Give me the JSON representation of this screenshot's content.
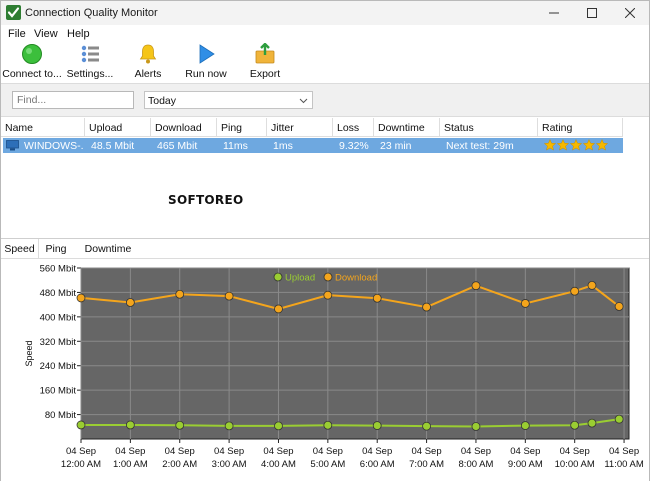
{
  "window": {
    "title": "Connection Quality Monitor"
  },
  "menu": [
    "File",
    "View",
    "Help"
  ],
  "toolbar": [
    {
      "label": "Connect to...",
      "icon": "green-circle-icon"
    },
    {
      "label": "Settings...",
      "icon": "settings-list-icon"
    },
    {
      "label": "Alerts",
      "icon": "bell-icon"
    },
    {
      "label": "Run now",
      "icon": "play-icon"
    },
    {
      "label": "Export",
      "icon": "export-icon"
    }
  ],
  "filter": {
    "find_placeholder": "Find...",
    "period_value": "Today"
  },
  "grid": {
    "columns": [
      "Name",
      "Upload",
      "Download",
      "Ping",
      "Jitter",
      "Loss",
      "Downtime",
      "Status",
      "Rating"
    ],
    "row": {
      "name": "WINDOWS-...",
      "upload": "48.5 Mbit",
      "download": "465 Mbit",
      "ping": "11ms",
      "jitter": "1ms",
      "loss": "9.32%",
      "downtime": "23 min",
      "status": "Next test: 29m",
      "rating": 5,
      "rating_max": 5
    }
  },
  "watermark": "SOFTOREO",
  "tabs": [
    "Speed",
    "Ping",
    "Downtime"
  ],
  "colors": {
    "selection": "#6ea8e0",
    "upload": "#9acd32",
    "download": "#f4a51c",
    "plot_bg": "#666666",
    "star": "#f5b800"
  },
  "chart_data": {
    "type": "line",
    "ylabel": "Speed",
    "ylim": [
      0,
      560
    ],
    "yticks": [
      80,
      160,
      240,
      320,
      400,
      480,
      560
    ],
    "ytick_labels": [
      "80 Mbit",
      "160 Mbit",
      "240 Mbit",
      "320 Mbit",
      "400 Mbit",
      "480 Mbit",
      "560 Mbit"
    ],
    "xlim": [
      0,
      11.1
    ],
    "x": [
      0,
      1,
      2,
      3,
      4,
      5,
      6,
      7,
      8,
      9,
      10,
      10.35,
      10.9
    ],
    "xtick_positions": [
      0,
      1,
      2,
      3,
      4,
      5,
      6,
      7,
      8,
      9,
      10,
      11
    ],
    "xtick_labels": [
      [
        "04 Sep",
        "12:00 AM"
      ],
      [
        "04 Sep",
        "1:00 AM"
      ],
      [
        "04 Sep",
        "2:00 AM"
      ],
      [
        "04 Sep",
        "3:00 AM"
      ],
      [
        "04 Sep",
        "4:00 AM"
      ],
      [
        "04 Sep",
        "5:00 AM"
      ],
      [
        "04 Sep",
        "6:00 AM"
      ],
      [
        "04 Sep",
        "7:00 AM"
      ],
      [
        "04 Sep",
        "8:00 AM"
      ],
      [
        "04 Sep",
        "9:00 AM"
      ],
      [
        "04 Sep",
        "10:00 AM"
      ],
      [
        "04 Sep",
        "11:00 AM"
      ]
    ],
    "series": [
      {
        "name": "Upload",
        "values": [
          46,
          46,
          45,
          43,
          43,
          45,
          44,
          42,
          41,
          44,
          45,
          52,
          65
        ]
      },
      {
        "name": "Download",
        "values": [
          462,
          447,
          474,
          468,
          426,
          471,
          461,
          432,
          502,
          444,
          484,
          503,
          434
        ]
      }
    ],
    "legend": "top-center",
    "grid": true
  }
}
